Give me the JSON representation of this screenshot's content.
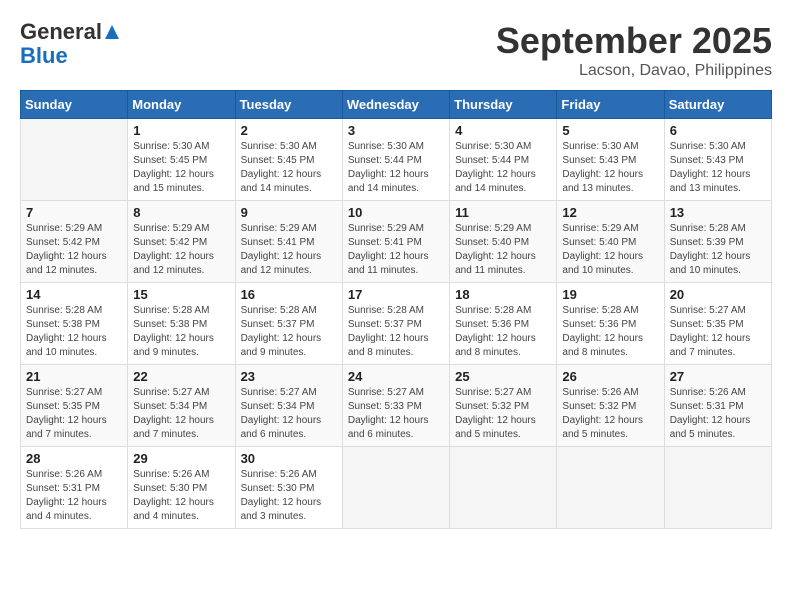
{
  "logo": {
    "general": "General",
    "blue": "Blue"
  },
  "title": "September 2025",
  "location": "Lacson, Davao, Philippines",
  "days_of_week": [
    "Sunday",
    "Monday",
    "Tuesday",
    "Wednesday",
    "Thursday",
    "Friday",
    "Saturday"
  ],
  "weeks": [
    [
      {
        "day": "",
        "info": ""
      },
      {
        "day": "1",
        "info": "Sunrise: 5:30 AM\nSunset: 5:45 PM\nDaylight: 12 hours\nand 15 minutes."
      },
      {
        "day": "2",
        "info": "Sunrise: 5:30 AM\nSunset: 5:45 PM\nDaylight: 12 hours\nand 14 minutes."
      },
      {
        "day": "3",
        "info": "Sunrise: 5:30 AM\nSunset: 5:44 PM\nDaylight: 12 hours\nand 14 minutes."
      },
      {
        "day": "4",
        "info": "Sunrise: 5:30 AM\nSunset: 5:44 PM\nDaylight: 12 hours\nand 14 minutes."
      },
      {
        "day": "5",
        "info": "Sunrise: 5:30 AM\nSunset: 5:43 PM\nDaylight: 12 hours\nand 13 minutes."
      },
      {
        "day": "6",
        "info": "Sunrise: 5:30 AM\nSunset: 5:43 PM\nDaylight: 12 hours\nand 13 minutes."
      }
    ],
    [
      {
        "day": "7",
        "info": "Sunrise: 5:29 AM\nSunset: 5:42 PM\nDaylight: 12 hours\nand 12 minutes."
      },
      {
        "day": "8",
        "info": "Sunrise: 5:29 AM\nSunset: 5:42 PM\nDaylight: 12 hours\nand 12 minutes."
      },
      {
        "day": "9",
        "info": "Sunrise: 5:29 AM\nSunset: 5:41 PM\nDaylight: 12 hours\nand 12 minutes."
      },
      {
        "day": "10",
        "info": "Sunrise: 5:29 AM\nSunset: 5:41 PM\nDaylight: 12 hours\nand 11 minutes."
      },
      {
        "day": "11",
        "info": "Sunrise: 5:29 AM\nSunset: 5:40 PM\nDaylight: 12 hours\nand 11 minutes."
      },
      {
        "day": "12",
        "info": "Sunrise: 5:29 AM\nSunset: 5:40 PM\nDaylight: 12 hours\nand 10 minutes."
      },
      {
        "day": "13",
        "info": "Sunrise: 5:28 AM\nSunset: 5:39 PM\nDaylight: 12 hours\nand 10 minutes."
      }
    ],
    [
      {
        "day": "14",
        "info": "Sunrise: 5:28 AM\nSunset: 5:38 PM\nDaylight: 12 hours\nand 10 minutes."
      },
      {
        "day": "15",
        "info": "Sunrise: 5:28 AM\nSunset: 5:38 PM\nDaylight: 12 hours\nand 9 minutes."
      },
      {
        "day": "16",
        "info": "Sunrise: 5:28 AM\nSunset: 5:37 PM\nDaylight: 12 hours\nand 9 minutes."
      },
      {
        "day": "17",
        "info": "Sunrise: 5:28 AM\nSunset: 5:37 PM\nDaylight: 12 hours\nand 8 minutes."
      },
      {
        "day": "18",
        "info": "Sunrise: 5:28 AM\nSunset: 5:36 PM\nDaylight: 12 hours\nand 8 minutes."
      },
      {
        "day": "19",
        "info": "Sunrise: 5:28 AM\nSunset: 5:36 PM\nDaylight: 12 hours\nand 8 minutes."
      },
      {
        "day": "20",
        "info": "Sunrise: 5:27 AM\nSunset: 5:35 PM\nDaylight: 12 hours\nand 7 minutes."
      }
    ],
    [
      {
        "day": "21",
        "info": "Sunrise: 5:27 AM\nSunset: 5:35 PM\nDaylight: 12 hours\nand 7 minutes."
      },
      {
        "day": "22",
        "info": "Sunrise: 5:27 AM\nSunset: 5:34 PM\nDaylight: 12 hours\nand 7 minutes."
      },
      {
        "day": "23",
        "info": "Sunrise: 5:27 AM\nSunset: 5:34 PM\nDaylight: 12 hours\nand 6 minutes."
      },
      {
        "day": "24",
        "info": "Sunrise: 5:27 AM\nSunset: 5:33 PM\nDaylight: 12 hours\nand 6 minutes."
      },
      {
        "day": "25",
        "info": "Sunrise: 5:27 AM\nSunset: 5:32 PM\nDaylight: 12 hours\nand 5 minutes."
      },
      {
        "day": "26",
        "info": "Sunrise: 5:26 AM\nSunset: 5:32 PM\nDaylight: 12 hours\nand 5 minutes."
      },
      {
        "day": "27",
        "info": "Sunrise: 5:26 AM\nSunset: 5:31 PM\nDaylight: 12 hours\nand 5 minutes."
      }
    ],
    [
      {
        "day": "28",
        "info": "Sunrise: 5:26 AM\nSunset: 5:31 PM\nDaylight: 12 hours\nand 4 minutes."
      },
      {
        "day": "29",
        "info": "Sunrise: 5:26 AM\nSunset: 5:30 PM\nDaylight: 12 hours\nand 4 minutes."
      },
      {
        "day": "30",
        "info": "Sunrise: 5:26 AM\nSunset: 5:30 PM\nDaylight: 12 hours\nand 3 minutes."
      },
      {
        "day": "",
        "info": ""
      },
      {
        "day": "",
        "info": ""
      },
      {
        "day": "",
        "info": ""
      },
      {
        "day": "",
        "info": ""
      }
    ]
  ]
}
